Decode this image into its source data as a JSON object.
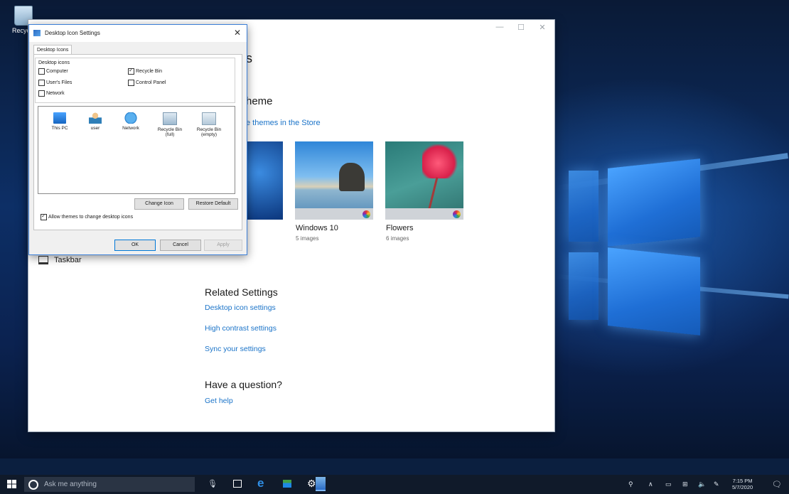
{
  "desktop": {
    "recycle_label": "Recycle"
  },
  "settings": {
    "title_fragment": "s",
    "theme_heading": "heme",
    "store_link": "e themes in the Store",
    "themes": [
      {
        "name": "Windows 10",
        "count": "5 images"
      },
      {
        "name": "Flowers",
        "count": "6 images"
      }
    ],
    "taskbar_item": "Taskbar",
    "related_heading": "Related Settings",
    "related_links": [
      "Desktop icon settings",
      "High contrast settings",
      "Sync your settings"
    ],
    "question_heading": "Have a question?",
    "help_link": "Get help"
  },
  "dialog": {
    "title": "Desktop Icon Settings",
    "tab": "Desktop Icons",
    "group_label": "Desktop icons",
    "checkboxes": [
      {
        "label": "Computer",
        "checked": false
      },
      {
        "label": "Recycle Bin",
        "checked": true
      },
      {
        "label": "User's Files",
        "checked": false
      },
      {
        "label": "Control Panel",
        "checked": false
      },
      {
        "label": "Network",
        "checked": false
      }
    ],
    "icons": [
      "This PC",
      "user",
      "Network",
      "Recycle Bin (full)",
      "Recycle Bin (empty)"
    ],
    "change_icon": "Change Icon",
    "restore_default": "Restore Default",
    "allow_themes": "Allow themes to change desktop icons",
    "ok": "OK",
    "cancel": "Cancel",
    "apply": "Apply"
  },
  "taskbar": {
    "search_placeholder": "Ask me anything",
    "time": "7:15 PM",
    "date": "5/7/2020"
  }
}
